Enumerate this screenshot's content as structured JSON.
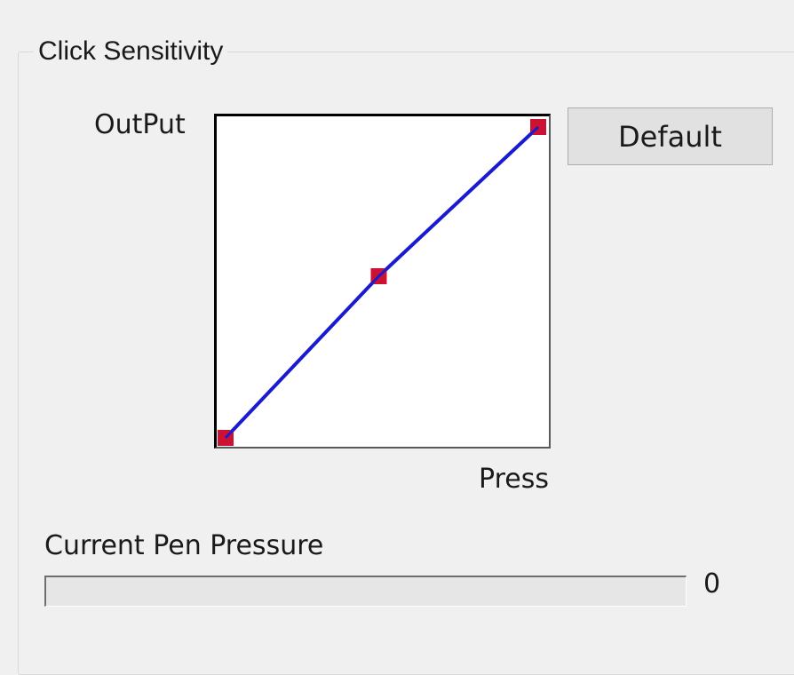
{
  "group": {
    "title": "Click Sensitivity"
  },
  "curve": {
    "output_label": "OutPut",
    "press_label": "Press",
    "line_color": "#1a1ad0",
    "point_color": "#cc1133",
    "points": [
      {
        "press": 0.0,
        "output": 0.0
      },
      {
        "press": 0.49,
        "output": 0.52
      },
      {
        "press": 1.0,
        "output": 1.0
      }
    ]
  },
  "buttons": {
    "default_label": "Default"
  },
  "pressure": {
    "label": "Current Pen Pressure",
    "value": "0",
    "fraction": 0
  }
}
